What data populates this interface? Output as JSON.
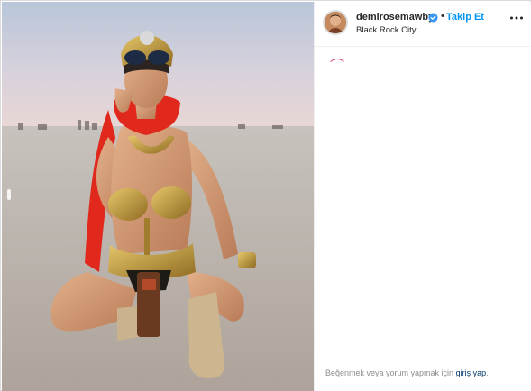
{
  "post": {
    "image_alt": "Photo of a woman in a gold costume and red scarf crouching on desert playa",
    "icons": {
      "verified": "verified-badge-icon",
      "more": "more-options-icon",
      "prev": "chevron-left-icon"
    }
  },
  "header": {
    "username": "demirosemawby",
    "separator": "•",
    "follow_label": "Takip Et",
    "location": "Black Rock City"
  },
  "footer": {
    "prompt_text": "Beğenmek veya yorum yapmak için ",
    "login_link": "giriş yap",
    "prompt_end": "."
  },
  "colors": {
    "accent": "#0095f6",
    "link": "#00376b",
    "muted": "#8e8e8e",
    "scarf_red": "#e0291c",
    "gold": "#c9a03a"
  }
}
